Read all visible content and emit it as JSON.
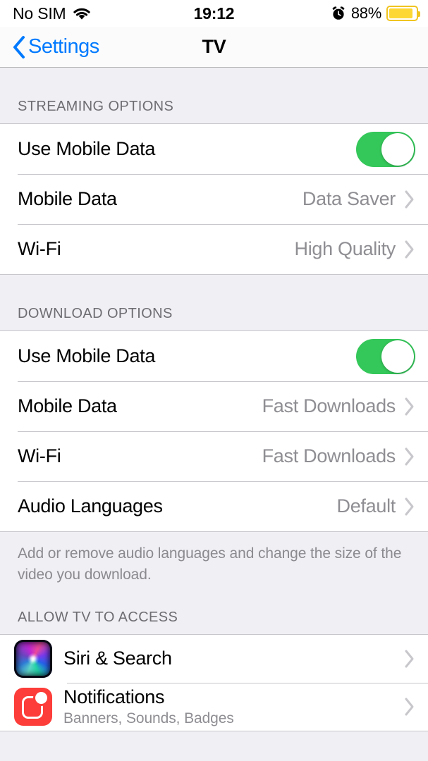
{
  "status_bar": {
    "carrier": "No SIM",
    "wifi_icon": "wifi-icon",
    "time": "19:12",
    "alarm_icon": "alarm-clock-icon",
    "battery_percent": "88%",
    "battery_level": 88,
    "battery_color": "#FDD835",
    "low_power_mode": true
  },
  "nav": {
    "back_label": "Settings",
    "back_icon": "chevron-left-icon",
    "title": "TV",
    "accent_color": "#007AFF"
  },
  "sections": [
    {
      "header": "STREAMING OPTIONS",
      "rows": [
        {
          "label": "Use Mobile Data",
          "control": "toggle",
          "toggle_on": true
        },
        {
          "label": "Mobile Data",
          "value": "Data Saver",
          "control": "disclosure"
        },
        {
          "label": "Wi-Fi",
          "value": "High Quality",
          "control": "disclosure"
        }
      ]
    },
    {
      "header": "DOWNLOAD OPTIONS",
      "rows": [
        {
          "label": "Use Mobile Data",
          "control": "toggle",
          "toggle_on": true
        },
        {
          "label": "Mobile Data",
          "value": "Fast Downloads",
          "control": "disclosure"
        },
        {
          "label": "Wi-Fi",
          "value": "Fast Downloads",
          "control": "disclosure"
        },
        {
          "label": "Audio Languages",
          "value": "Default",
          "control": "disclosure"
        }
      ],
      "footer": "Add or remove audio languages and change the size of the video you download."
    },
    {
      "header": "ALLOW TV TO ACCESS",
      "rows": [
        {
          "label": "Siri & Search",
          "icon": "siri-icon",
          "control": "disclosure"
        },
        {
          "label": "Notifications",
          "subtitle": "Banners, Sounds, Badges",
          "icon": "notifications-icon",
          "control": "disclosure"
        }
      ]
    }
  ],
  "colors": {
    "toggle_on": "#34C759",
    "group_background": "#FFFFFF",
    "page_background": "#EFEFF4",
    "separator": "#C8C7CC",
    "secondary_text": "#8E8E93",
    "header_text": "#6D6D72",
    "notifications_icon": "#FC3D39"
  }
}
